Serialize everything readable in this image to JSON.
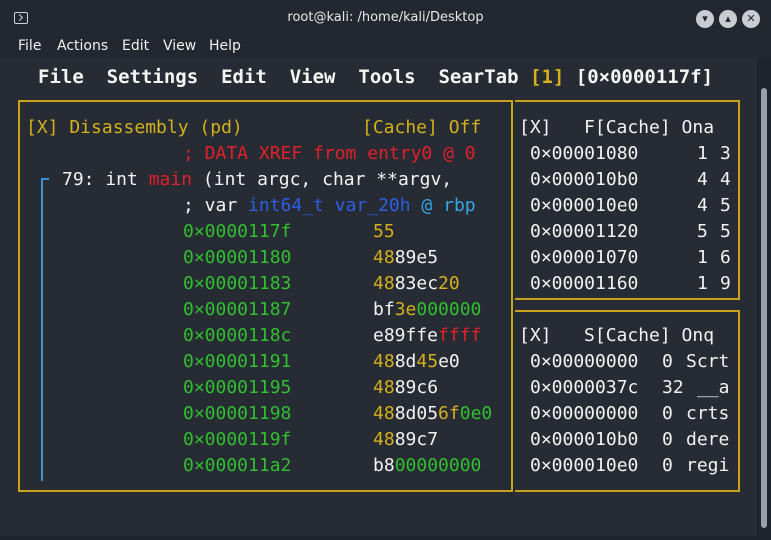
{
  "window": {
    "title": "root@kali: /home/kali/Desktop"
  },
  "menubar": [
    "File",
    "Actions",
    "Edit",
    "View",
    "Help"
  ],
  "r2_menu": {
    "items": [
      "File",
      "Settings",
      "Edit",
      "View",
      "Tools",
      "SearTab"
    ],
    "tab_index": "[1]",
    "address": "[0×0000117f]"
  },
  "disasm": {
    "header_left": "[X] Disassembly (pd)",
    "header_right": "[Cache] Off",
    "xref": "; DATA XREF from entry0 @ 0",
    "func_num": "79: int ",
    "func_name": "main",
    "func_args": " (int argc, char **argv,",
    "var_prefix": "; var ",
    "var_type": "int64_t",
    "var_name": " var_20h",
    "var_at": " @ ",
    "var_reg": "rbp",
    "rows": [
      {
        "addr": "0×0000117f",
        "b1": "55",
        "b2": "",
        "b3": ""
      },
      {
        "addr": "0×00001180",
        "b1": "48",
        "b2": "89e5",
        "b3": ""
      },
      {
        "addr": "0×00001183",
        "b1": "48",
        "b2": "83ec",
        "b3": "20"
      },
      {
        "addr": "0×00001187",
        "b1": "bf",
        "b2": "3e",
        "b3": "000000"
      },
      {
        "addr": "0×0000118c",
        "b1": "e89ffe",
        "b2": "ffff",
        "b3": ""
      },
      {
        "addr": "0×00001191",
        "b1": "48",
        "b2": "8d",
        "b3": "45",
        "b4": "e0"
      },
      {
        "addr": "0×00001195",
        "b1": "48",
        "b2": "89c6",
        "b3": ""
      },
      {
        "addr": "0×00001198",
        "b1": "48",
        "b2": "8d05",
        "b3": "6f",
        "b4": "0e0"
      },
      {
        "addr": "0×0000119f",
        "b1": "48",
        "b2": "89c7",
        "b3": ""
      },
      {
        "addr": "0×000011a2",
        "b1": "b8",
        "b2": "00000000",
        "b3": ""
      }
    ]
  },
  "functions": {
    "header": "[X]   F[Cache] Ona",
    "rows": [
      {
        "addr": "0×00001080",
        "a": "1",
        "b": "3"
      },
      {
        "addr": "0×000010b0",
        "a": "4",
        "b": "4"
      },
      {
        "addr": "0×000010e0",
        "a": "4",
        "b": "5"
      },
      {
        "addr": "0×00001120",
        "a": "5",
        "b": "5"
      },
      {
        "addr": "0×00001070",
        "a": "1",
        "b": "6"
      },
      {
        "addr": "0×00001160",
        "a": "1",
        "b": "9"
      }
    ]
  },
  "sections": {
    "header": "[X]   S[Cache] Onq",
    "rows": [
      {
        "addr": "0×00000000",
        "size": "0",
        "name": "Scrt"
      },
      {
        "addr": "0×0000037c",
        "size": "32",
        "name": "__a"
      },
      {
        "addr": "0×00000000",
        "size": "0",
        "name": "crts"
      },
      {
        "addr": "0×000010b0",
        "size": "0",
        "name": "dere"
      },
      {
        "addr": "0×000010e0",
        "size": "0",
        "name": "regi"
      }
    ]
  }
}
